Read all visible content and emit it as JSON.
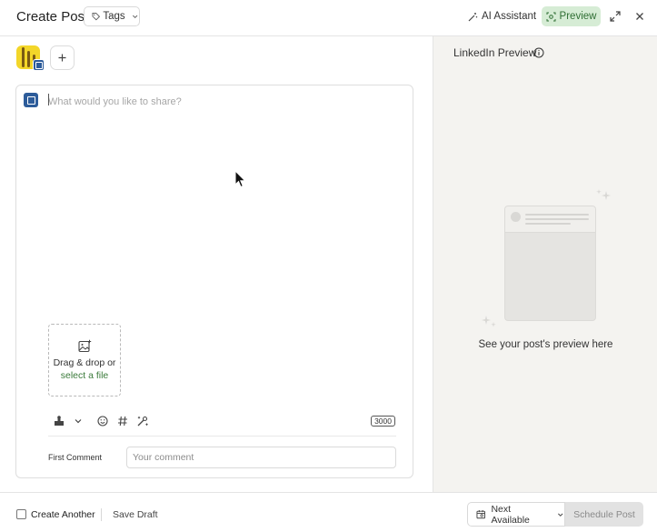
{
  "header": {
    "title": "Create Post",
    "tags_label": "Tags",
    "ai_label": "AI Assistant",
    "preview_label": "Preview"
  },
  "composer": {
    "placeholder": "What would you like to share?",
    "dropzone_text": "Drag & drop or",
    "dropzone_link": "select a file",
    "char_count": "3000",
    "first_comment_label": "First Comment",
    "first_comment_placeholder": "Your comment"
  },
  "preview_panel": {
    "title": "LinkedIn Preview",
    "empty_text": "See your post's preview here"
  },
  "footer": {
    "create_another_label": "Create Another",
    "save_draft_label": "Save Draft",
    "next_available_label": "Next Available",
    "schedule_label": "Schedule Post"
  },
  "colors": {
    "accent_green": "#d6ecd5",
    "linkedin_blue": "#2d5c9a",
    "avatar_yellow": "#f3d629"
  },
  "icons": [
    "tag-icon",
    "chevron-down-icon",
    "wand-icon",
    "preview-icon",
    "expand-icon",
    "close-icon",
    "plus-icon",
    "linkedin-icon",
    "image-add-icon",
    "stamp-icon",
    "emoji-icon",
    "hashtag-icon",
    "ai-sparkle-icon",
    "info-icon",
    "calendar-icon"
  ]
}
